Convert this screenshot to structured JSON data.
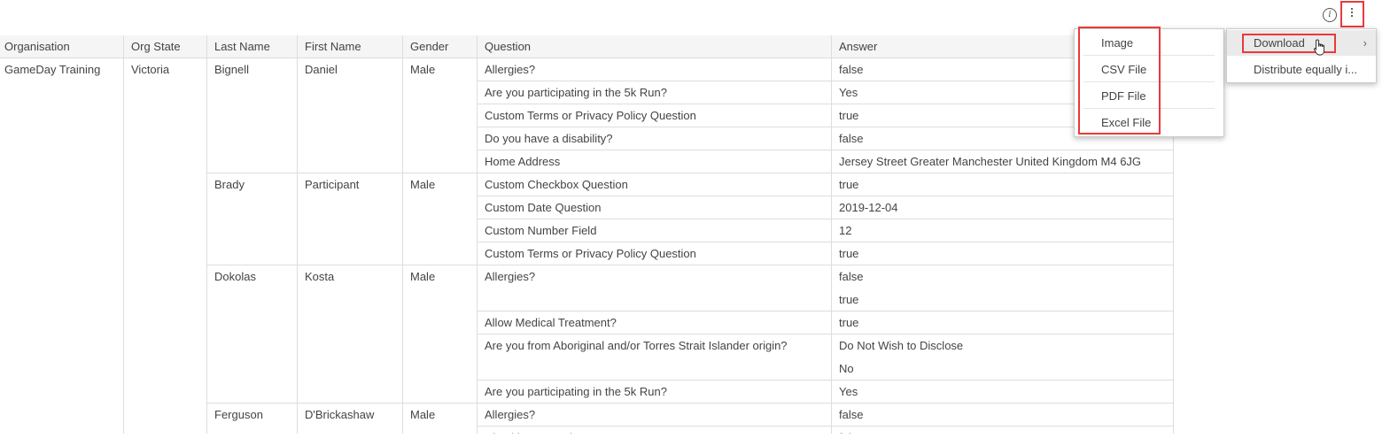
{
  "toolbar": {
    "info_icon": "info-icon",
    "more_icon": "vertical-dots-icon",
    "highlight_color": "#e83a3a"
  },
  "table": {
    "columns": [
      "Organisation",
      "Org State",
      "Last Name",
      "First Name",
      "Gender",
      "Question",
      "Answer"
    ],
    "organisation": "GameDay Training",
    "org_state": "Victoria",
    "people": [
      {
        "last_name": "Bignell",
        "first_name": "Daniel",
        "gender": "Male",
        "rows": [
          {
            "q": "Allergies?",
            "a": [
              "false"
            ]
          },
          {
            "q": "Are you participating in the 5k Run?",
            "a": [
              "Yes"
            ]
          },
          {
            "q": "Custom Terms or Privacy Policy Question",
            "a": [
              "true"
            ]
          },
          {
            "q": "Do you have a disability?",
            "a": [
              "false"
            ]
          },
          {
            "q": "Home Address",
            "a": [
              "Jersey Street Greater Manchester United Kingdom M4 6JG"
            ]
          }
        ]
      },
      {
        "last_name": "Brady",
        "first_name": "Participant",
        "gender": "Male",
        "rows": [
          {
            "q": "Custom Checkbox Question",
            "a": [
              "true"
            ]
          },
          {
            "q": "Custom Date Question",
            "a": [
              "2019-12-04"
            ]
          },
          {
            "q": "Custom Number Field",
            "a": [
              "12"
            ]
          },
          {
            "q": "Custom Terms or Privacy Policy Question",
            "a": [
              "true"
            ]
          }
        ]
      },
      {
        "last_name": "Dokolas",
        "first_name": "Kosta",
        "gender": "Male",
        "rows": [
          {
            "q": "Allergies?",
            "a": [
              "false",
              "true"
            ]
          },
          {
            "q": "Allow Medical Treatment?",
            "a": [
              "true"
            ]
          },
          {
            "q": "Are you from Aboriginal and/or Torres Strait Islander origin?",
            "a": [
              "Do Not Wish to Disclose",
              "No"
            ]
          },
          {
            "q": "Are you participating in the 5k Run?",
            "a": [
              "Yes"
            ]
          }
        ]
      },
      {
        "last_name": "Ferguson",
        "first_name": "D'Brickashaw",
        "gender": "Male",
        "rows": [
          {
            "q": "Allergies?",
            "a": [
              "false"
            ]
          },
          {
            "q": "Checkbox Question",
            "a": [
              "false"
            ]
          }
        ]
      }
    ]
  },
  "download_submenu": {
    "items": [
      "Image",
      "CSV File",
      "PDF File",
      "Excel File"
    ]
  },
  "context_menu": {
    "download_label": "Download",
    "distribute_label": "Distribute equally i...",
    "chevron_icon": "chevron-right-icon",
    "cursor_icon": "hand-pointer-icon"
  }
}
